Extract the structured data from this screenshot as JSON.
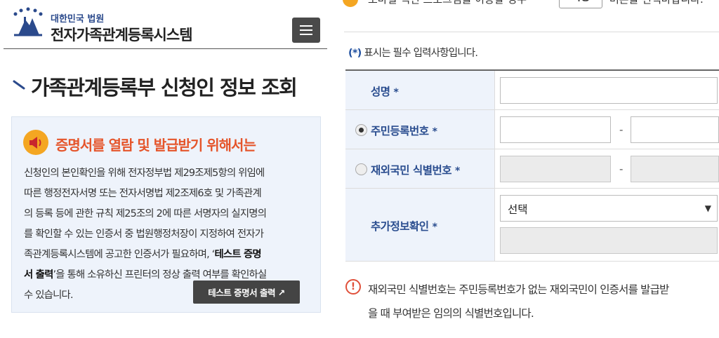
{
  "header": {
    "org_name": "대한민국 법원",
    "system_name": "전자가족관계등록시스템"
  },
  "page": {
    "title": "가족관계등록부 신청인 정보 조회"
  },
  "notice": {
    "title": "증명서를 열람 및 발급받기 위해서는",
    "lines": [
      "신청인의 본인확인을 위해 전자정부법 제29조제5항의 위임에",
      "따른 행정전자서명 또는 전자서명법 제2조제6호 및 가족관계",
      "의 등록 등에 관한 규칙 제25조의 2에 따른 서명자의 실지명의",
      "를 확인할 수 있는 인증서 중 법원행정처장이 지정하여 전자가",
      "족관계등록시스템에 공고한 인증서가 필요하며, ‘",
      "테스트 증명",
      "서 출력",
      "’을 통해 소유하신 프린터의 정상 출력 여부를 확인하실",
      "수 있습니다."
    ],
    "test_button": "테스트 증명서 출력 ↗"
  },
  "top": {
    "text_before": "모바일 백신 프로그램을 이용할 경우",
    "apply_button": "적용",
    "text_after": "버튼을 선택바랍니다."
  },
  "required_note": {
    "star": "(*)",
    "text": " 표시는 필수 입력사항입니다."
  },
  "form": {
    "name_label": "성명",
    "rrn_label": "주민등록번호",
    "foreigner_label": "재외국민 식별번호",
    "extra_label": "추가정보확인",
    "required_mark": "*",
    "dash": "-",
    "select_value": "선택"
  },
  "info": {
    "icon": "!",
    "lines": [
      "재외국민 식별번호는 주민등록번호가 없는 재외국민이 인증서를 발급받",
      "을 때 부여받은 임의의 식별번호입니다."
    ]
  },
  "colors": {
    "brand_blue": "#2a4d8f",
    "accent_orange": "#e5552b",
    "notice_bg": "#eef3fb"
  }
}
